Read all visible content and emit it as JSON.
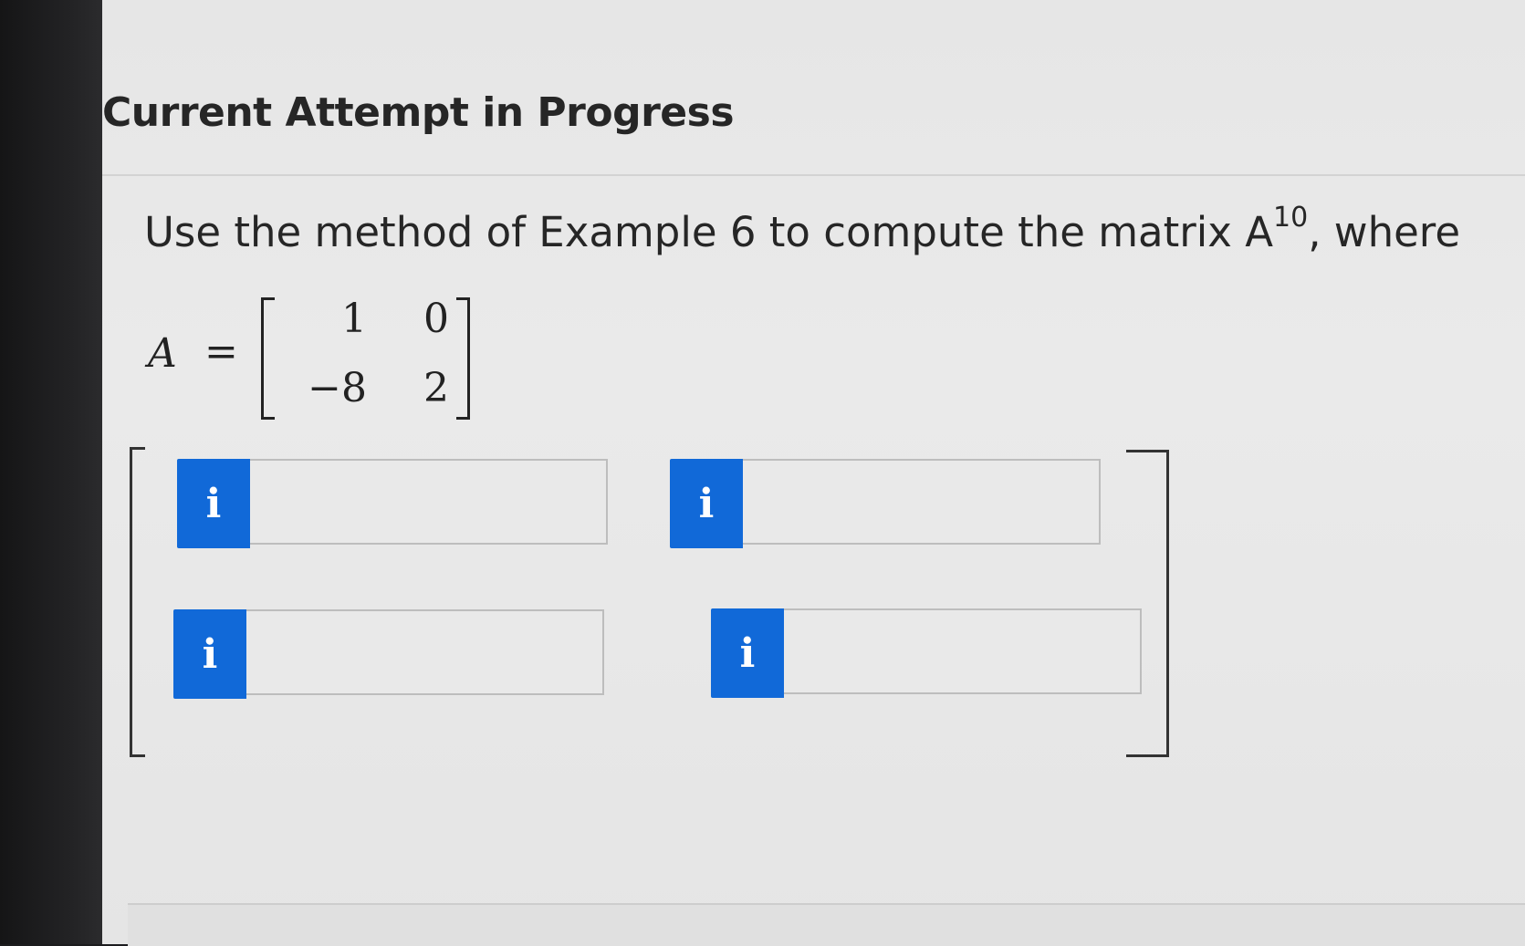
{
  "page": {
    "heading": "Current Attempt in Progress"
  },
  "question": {
    "text_before": "Use the method of Example 6 to compute the matrix A",
    "exponent": "10",
    "text_after": ", where"
  },
  "given_matrix": {
    "variable": "A",
    "equals": "=",
    "rows": [
      [
        "1",
        "0"
      ],
      [
        "−8",
        "2"
      ]
    ]
  },
  "answer_matrix": {
    "info_icon_glyph": "i",
    "cells": [
      {
        "value": "",
        "placeholder": ""
      },
      {
        "value": "",
        "placeholder": ""
      },
      {
        "value": "",
        "placeholder": ""
      },
      {
        "value": "",
        "placeholder": ""
      }
    ]
  },
  "colors": {
    "info_button": "#1169d8"
  }
}
